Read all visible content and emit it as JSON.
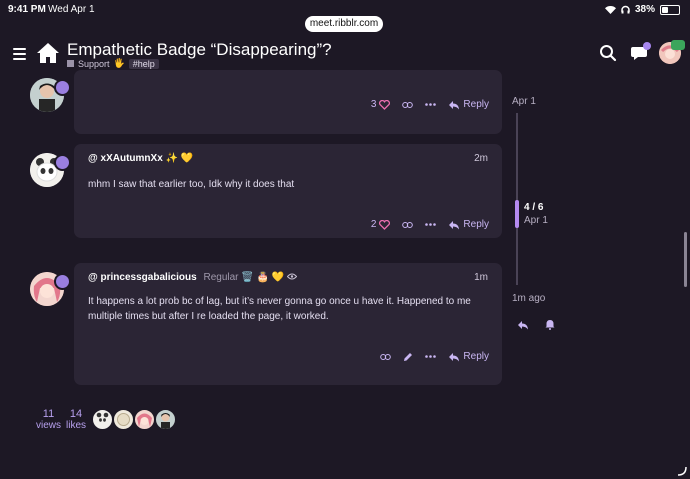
{
  "status_bar": {
    "time": "9:41 PM",
    "date": "Wed Apr 1",
    "battery": "38%",
    "battery_level": 0.38
  },
  "browser": {
    "url": "meet.ribblr.com"
  },
  "header": {
    "title": "Empathetic Badge “Disappearing”?",
    "category": "Support",
    "category_emoji": "🖐",
    "tag": "#help"
  },
  "posts": [
    {
      "actions": {
        "like_count": "3",
        "reply": "Reply"
      }
    },
    {
      "username": "@ xXAutumnXx",
      "username_emojis": "✨ 💛",
      "time": "2m",
      "text": "mhm I saw that earlier too, Idk why it does that",
      "actions": {
        "like_count": "2",
        "reply": "Reply"
      }
    },
    {
      "username": "@ princessgabalicious",
      "title_badge": "Regular",
      "username_emojis": "🗑️ 🎂 💛",
      "time": "1m",
      "text": "It happens a lot prob bc of lag, but it’s never gonna go once u have it. Happened to me multiple times but after I re loaded the page, it worked.",
      "actions": {
        "reply": "Reply"
      }
    }
  ],
  "timeline": {
    "top_date": "Apr 1",
    "position": "4 / 6",
    "position_date": "Apr 1",
    "bottom_label": "1m ago"
  },
  "topic_stats": {
    "views": "11",
    "views_label": "views",
    "likes": "14",
    "likes_label": "likes"
  },
  "icons": [
    "menu-icon",
    "home-icon",
    "search-icon",
    "chat-icon",
    "heart-icon",
    "link-icon",
    "more-icon",
    "reply-icon",
    "edit-icon",
    "bell-icon",
    "eye-icon",
    "wifi-icon",
    "headphones-icon",
    "battery-icon"
  ],
  "colors": {
    "background": "#1d1825",
    "card": "#2b2535",
    "accent": "#c9b6f2",
    "heart": "#ec6fb0"
  }
}
